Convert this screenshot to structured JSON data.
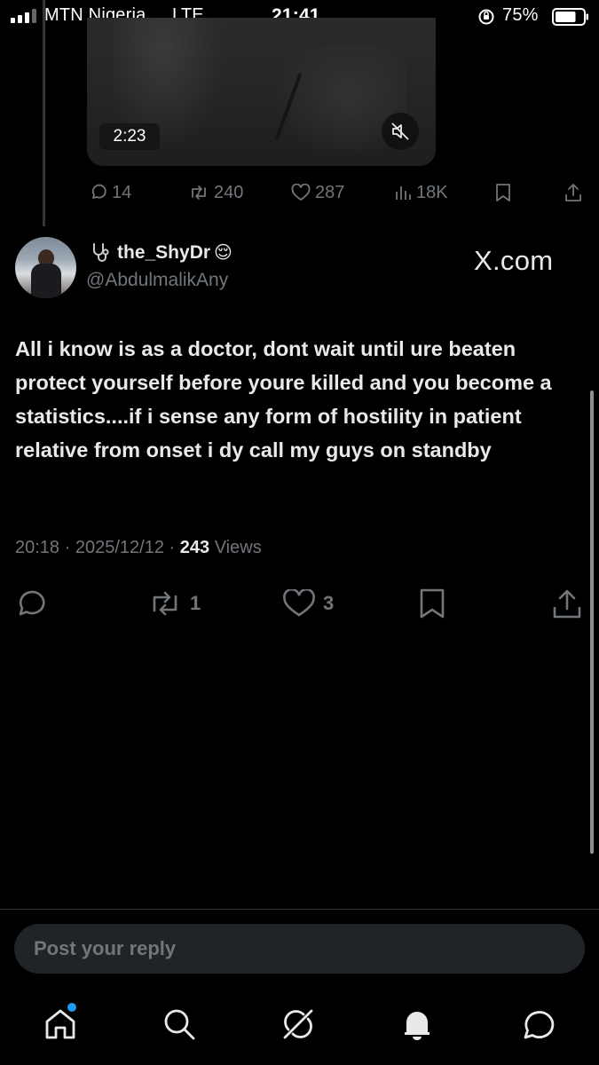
{
  "status_bar": {
    "carrier": "MTN Nigeria",
    "network": "LTE",
    "time": "21:41",
    "battery_percent": "75%",
    "battery_level": 0.75
  },
  "quoted_post": {
    "video_duration": "2:23",
    "replies": "14",
    "reposts": "240",
    "likes": "287",
    "views": "18K"
  },
  "post": {
    "author_name": "the_ShyDr",
    "author_handle": "@AbdulmalikAny",
    "name_prefix_icon": "stethoscope-icon",
    "name_suffix_emoji": "😌",
    "watermark": "X.com",
    "text": "All i know is as a doctor, dont wait until ure beaten protect yourself before youre killed and you become a statistics....if i sense any form of hostility in patient relative from onset i dy call my guys on standby",
    "time": "20:18",
    "separator": "·",
    "date": "2025/12/12",
    "views_count": "243",
    "views_label": "Views",
    "reposts": "1",
    "likes": "3"
  },
  "reply": {
    "placeholder": "Post your reply"
  },
  "tabbar": {
    "items": [
      "home-icon",
      "search-icon",
      "grok-icon",
      "notifications-icon",
      "messages-icon"
    ]
  },
  "colors": {
    "background": "#000000",
    "text": "#e7e9ea",
    "muted": "#71767b",
    "accent": "#1d9bf0"
  }
}
